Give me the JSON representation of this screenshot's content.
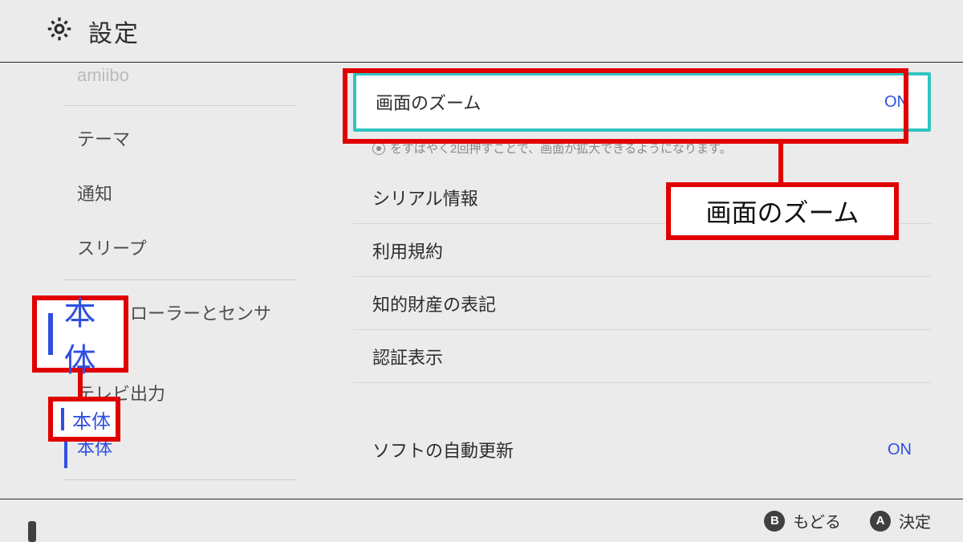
{
  "header": {
    "title": "設定"
  },
  "sidebar": {
    "items": [
      {
        "label": "amiibo",
        "cut": true
      },
      {
        "divider": true
      },
      {
        "label": "テーマ"
      },
      {
        "label": "通知"
      },
      {
        "label": "スリープ"
      },
      {
        "divider": true
      },
      {
        "label": "コントローラーとセンサー"
      },
      {
        "label": "テレビ出力"
      },
      {
        "label": "本体",
        "active": true
      },
      {
        "divider": true
      }
    ]
  },
  "content": {
    "zoom": {
      "label": "画面のズーム",
      "value": "ON"
    },
    "zoom_hint": "をすばやく2回押すことで、画面が拡大できるようになります。",
    "rows": [
      {
        "label": "シリアル情報"
      },
      {
        "label": "利用規約"
      },
      {
        "label": "知的財産の表記"
      },
      {
        "label": "認証表示"
      }
    ],
    "auto_update": {
      "label": "ソフトの自動更新",
      "value": "ON"
    }
  },
  "footer": {
    "back": {
      "btn": "B",
      "label": "もどる"
    },
    "ok": {
      "btn": "A",
      "label": "決定"
    }
  },
  "annotations": {
    "zoom_callout": "画面のズーム",
    "system_big": "本体",
    "system_small": "本体"
  }
}
